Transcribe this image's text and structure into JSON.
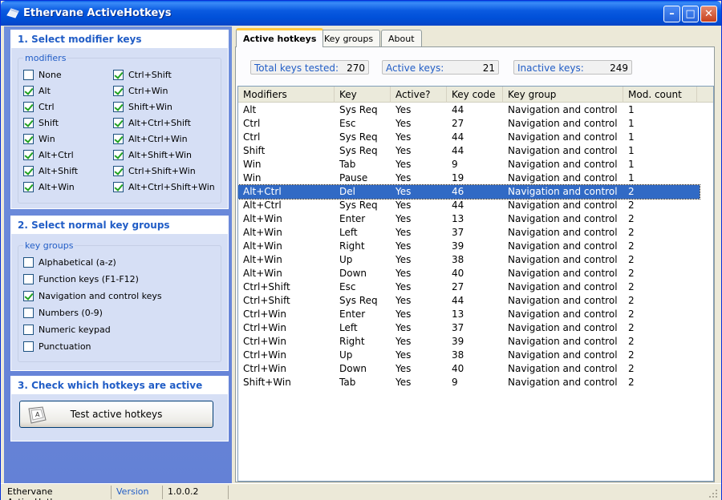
{
  "window": {
    "title": "Ethervane ActiveHotkeys",
    "btn_min": "–",
    "btn_max": "□",
    "btn_close": "✕"
  },
  "panel1": {
    "title": "1. Select modifier keys",
    "legend": "modifiers",
    "items": [
      {
        "label": "None",
        "checked": false
      },
      {
        "label": "Alt",
        "checked": true
      },
      {
        "label": "Ctrl",
        "checked": true
      },
      {
        "label": "Shift",
        "checked": true
      },
      {
        "label": "Win",
        "checked": true
      },
      {
        "label": "Alt+Ctrl",
        "checked": true
      },
      {
        "label": "Alt+Shift",
        "checked": true
      },
      {
        "label": "Alt+Win",
        "checked": true
      },
      {
        "label": "Ctrl+Shift",
        "checked": true
      },
      {
        "label": "Ctrl+Win",
        "checked": true
      },
      {
        "label": "Shift+Win",
        "checked": true
      },
      {
        "label": "Alt+Ctrl+Shift",
        "checked": true
      },
      {
        "label": "Alt+Ctrl+Win",
        "checked": true
      },
      {
        "label": "Alt+Shift+Win",
        "checked": true
      },
      {
        "label": "Ctrl+Shift+Win",
        "checked": true
      },
      {
        "label": "Alt+Ctrl+Shift+Win",
        "checked": true
      }
    ]
  },
  "panel2": {
    "title": "2. Select normal key groups",
    "legend": "key groups",
    "items": [
      {
        "label": "Alphabetical (a-z)",
        "checked": false
      },
      {
        "label": "Function keys (F1-F12)",
        "checked": false
      },
      {
        "label": "Navigation and control keys",
        "checked": true
      },
      {
        "label": "Numbers (0-9)",
        "checked": false
      },
      {
        "label": "Numeric keypad",
        "checked": false
      },
      {
        "label": "Punctuation",
        "checked": false
      }
    ]
  },
  "panel3": {
    "title": "3. Check which hotkeys are active",
    "button_label": "Test active hotkeys"
  },
  "tabs": [
    "Active hotkeys",
    "Key groups",
    "About"
  ],
  "stats": {
    "total_label": "Total keys tested:",
    "total_value": "270",
    "active_label": "Active keys:",
    "active_value": "21",
    "inactive_label": "Inactive keys:",
    "inactive_value": "249"
  },
  "table": {
    "columns": [
      "Modifiers",
      "Key",
      "Active?",
      "Key code",
      "Key group",
      "Mod. count"
    ],
    "selected_row": 6,
    "rows": [
      [
        "Alt",
        "Sys Req",
        "Yes",
        "44",
        "Navigation and control",
        "1"
      ],
      [
        "Ctrl",
        "Esc",
        "Yes",
        "27",
        "Navigation and control",
        "1"
      ],
      [
        "Ctrl",
        "Sys Req",
        "Yes",
        "44",
        "Navigation and control",
        "1"
      ],
      [
        "Shift",
        "Sys Req",
        "Yes",
        "44",
        "Navigation and control",
        "1"
      ],
      [
        "Win",
        "Tab",
        "Yes",
        "9",
        "Navigation and control",
        "1"
      ],
      [
        "Win",
        "Pause",
        "Yes",
        "19",
        "Navigation and control",
        "1"
      ],
      [
        "Alt+Ctrl",
        "Del",
        "Yes",
        "46",
        "Navigation and control",
        "2"
      ],
      [
        "Alt+Ctrl",
        "Sys Req",
        "Yes",
        "44",
        "Navigation and control",
        "2"
      ],
      [
        "Alt+Win",
        "Enter",
        "Yes",
        "13",
        "Navigation and control",
        "2"
      ],
      [
        "Alt+Win",
        "Left",
        "Yes",
        "37",
        "Navigation and control",
        "2"
      ],
      [
        "Alt+Win",
        "Right",
        "Yes",
        "39",
        "Navigation and control",
        "2"
      ],
      [
        "Alt+Win",
        "Up",
        "Yes",
        "38",
        "Navigation and control",
        "2"
      ],
      [
        "Alt+Win",
        "Down",
        "Yes",
        "40",
        "Navigation and control",
        "2"
      ],
      [
        "Ctrl+Shift",
        "Esc",
        "Yes",
        "27",
        "Navigation and control",
        "2"
      ],
      [
        "Ctrl+Shift",
        "Sys Req",
        "Yes",
        "44",
        "Navigation and control",
        "2"
      ],
      [
        "Ctrl+Win",
        "Enter",
        "Yes",
        "13",
        "Navigation and control",
        "2"
      ],
      [
        "Ctrl+Win",
        "Left",
        "Yes",
        "37",
        "Navigation and control",
        "2"
      ],
      [
        "Ctrl+Win",
        "Right",
        "Yes",
        "39",
        "Navigation and control",
        "2"
      ],
      [
        "Ctrl+Win",
        "Up",
        "Yes",
        "38",
        "Navigation and control",
        "2"
      ],
      [
        "Ctrl+Win",
        "Down",
        "Yes",
        "40",
        "Navigation and control",
        "2"
      ],
      [
        "Shift+Win",
        "Tab",
        "Yes",
        "9",
        "Navigation and control",
        "2"
      ]
    ]
  },
  "statusbar": {
    "app": "Ethervane ActiveHotkeys",
    "version_label": "Version",
    "version": "1.0.0.2"
  },
  "colors": {
    "accent": "#215dc6",
    "selection": "#316ac5",
    "titlebar": "#0a5ae0"
  },
  "icons": {
    "app": "app-logo-icon",
    "test": "keyboard-key-icon",
    "grip": "resize-grip-icon"
  }
}
